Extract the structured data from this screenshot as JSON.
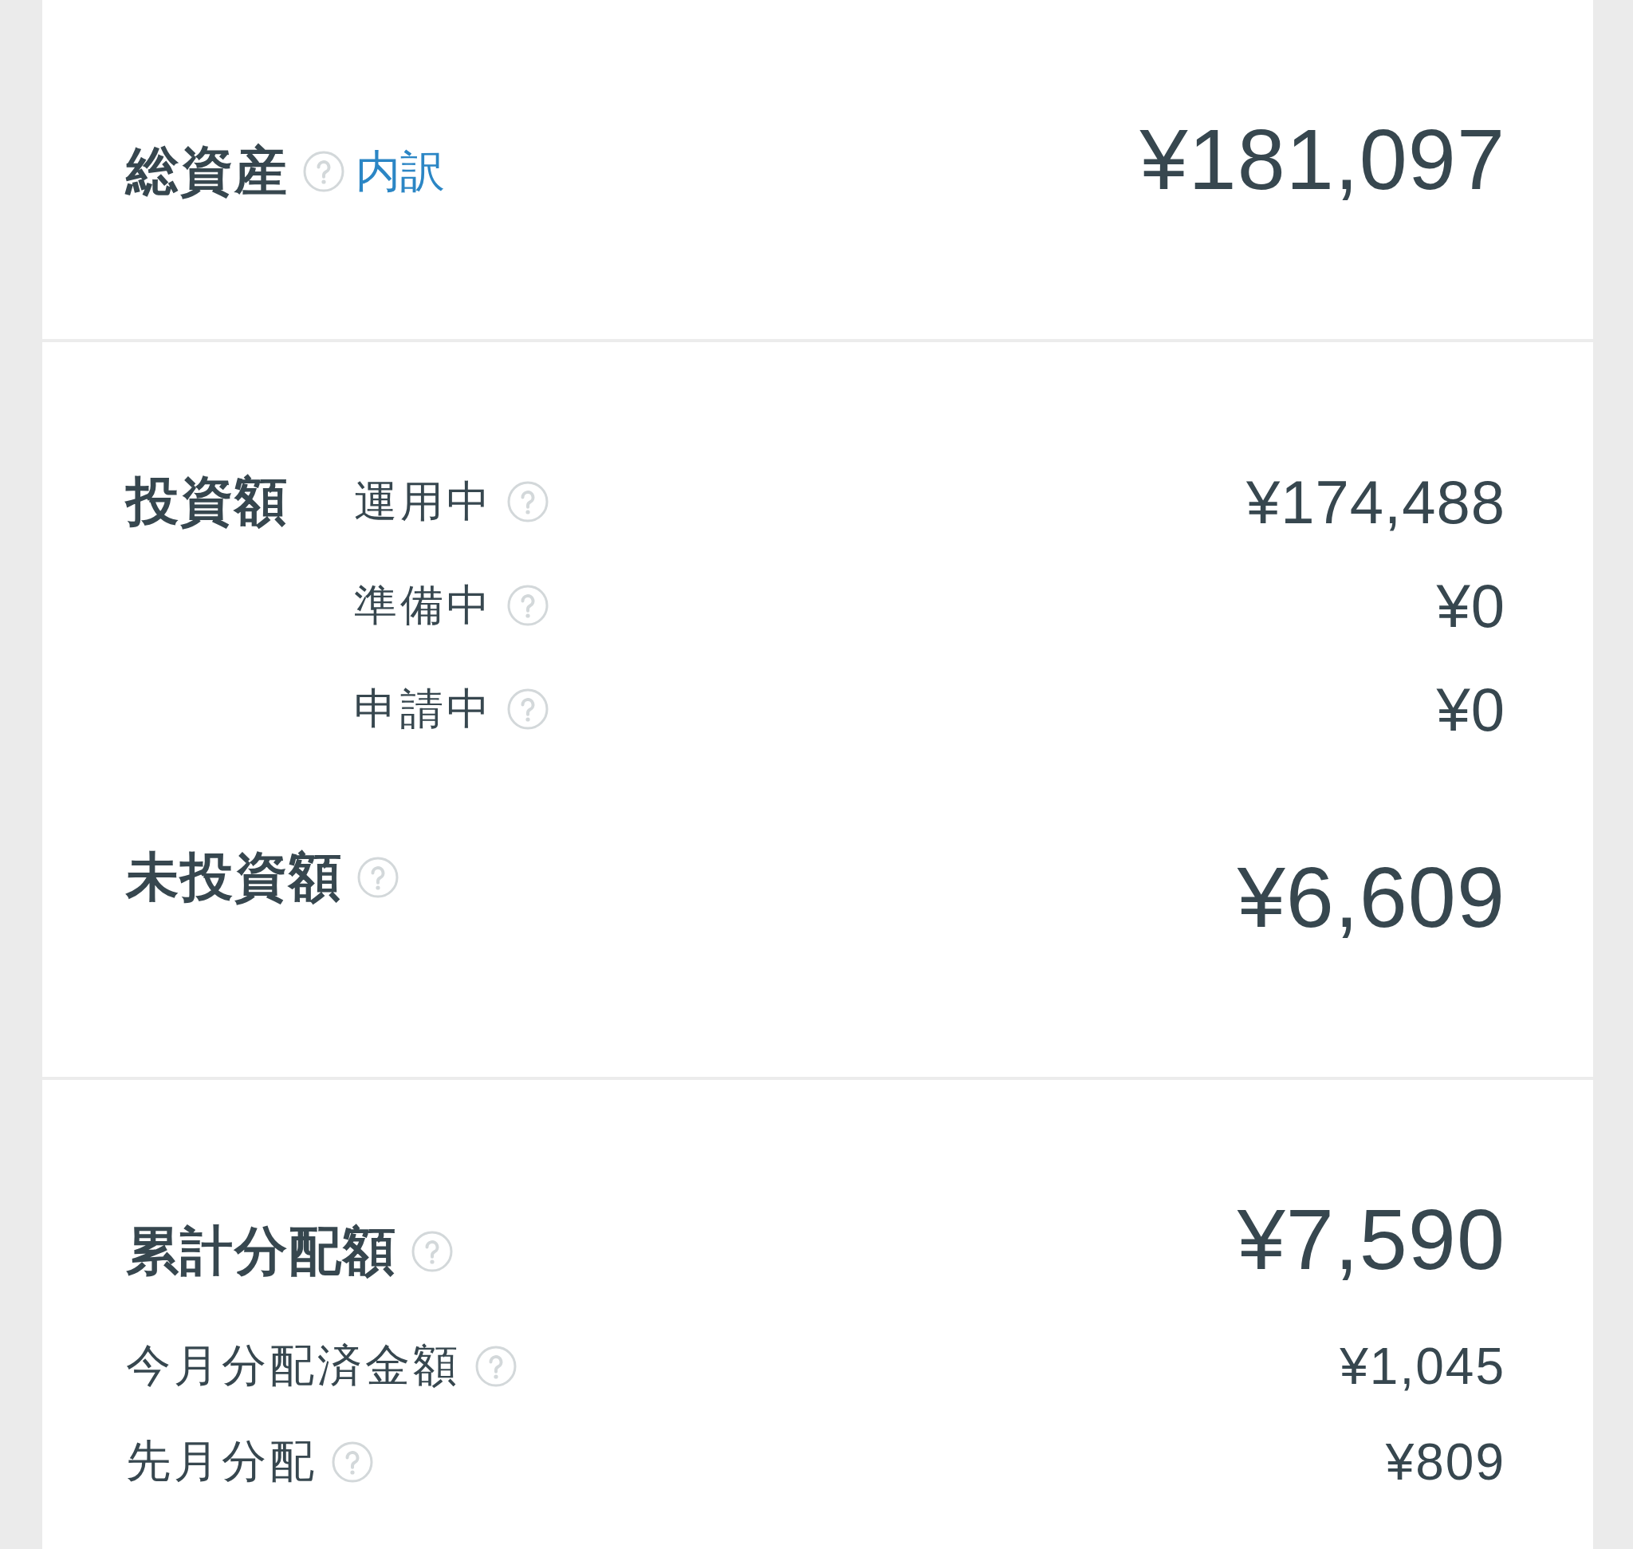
{
  "sections": [
    {
      "blocks": [
        {
          "kind": "headline",
          "label": "総資産",
          "help": true,
          "link": "内訳",
          "value": "¥181,097"
        }
      ]
    },
    {
      "blocks": [
        {
          "kind": "group",
          "label": "投資額",
          "help": false,
          "rows": [
            {
              "label": "運用中",
              "help": true,
              "value": "¥174,488"
            },
            {
              "label": "準備中",
              "help": true,
              "value": "¥0"
            },
            {
              "label": "申請中",
              "help": true,
              "value": "¥0"
            }
          ]
        },
        {
          "kind": "headline",
          "label": "未投資額",
          "help": true,
          "value": "¥6,609"
        }
      ]
    },
    {
      "blocks": [
        {
          "kind": "headline",
          "label": "累計分配額",
          "help": true,
          "value": "¥7,590"
        },
        {
          "kind": "list",
          "rows": [
            {
              "label": "今月分配済金額",
              "help": true,
              "value": "¥1,045"
            },
            {
              "label": "先月分配",
              "help": true,
              "value": "¥809"
            }
          ]
        }
      ]
    }
  ]
}
